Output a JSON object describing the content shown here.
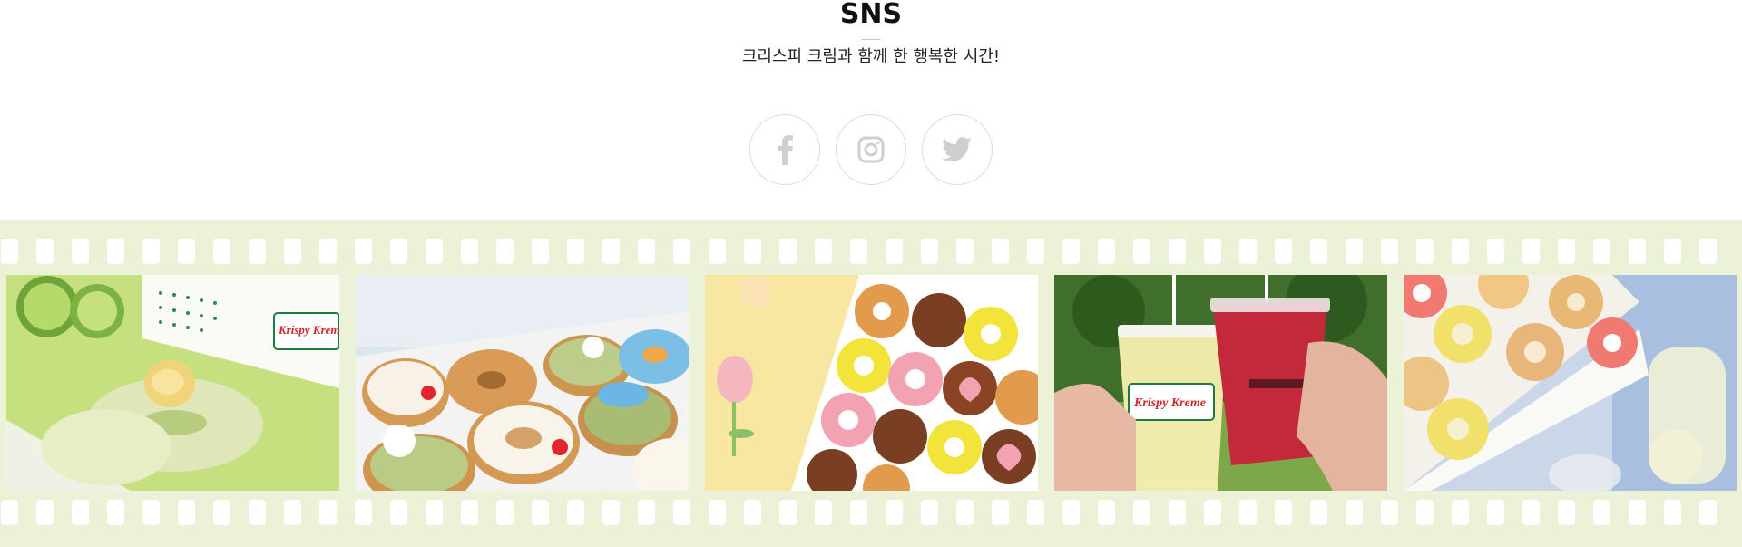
{
  "section": {
    "title": "SNS",
    "subtitle": "크리스피 크림과 함께 한 행복한 시간!"
  },
  "social_links": [
    {
      "name": "facebook",
      "icon": "facebook-icon"
    },
    {
      "name": "instagram",
      "icon": "instagram-icon"
    },
    {
      "name": "twitter",
      "icon": "twitter-icon"
    }
  ],
  "gallery": {
    "photos": [
      {
        "subject": "lime glazed donut with lime slices"
      },
      {
        "subject": "box of decorated donuts"
      },
      {
        "subject": "donuts box with flowers and hearts"
      },
      {
        "subject": "two iced drinks held in hands"
      },
      {
        "subject": "lemon glazed donuts box at picnic"
      }
    ],
    "box_text": "Krispy Kreme"
  },
  "colors": {
    "film_strip": "#ebf2d8",
    "icon_gray": "#cfcfcf",
    "circle_border": "#dcdcdc"
  }
}
